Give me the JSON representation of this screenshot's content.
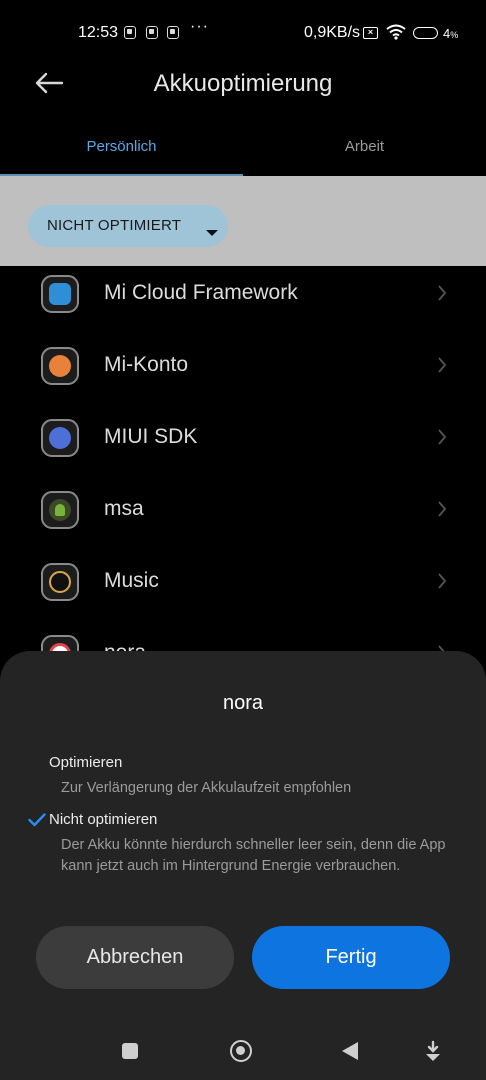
{
  "status_bar": {
    "time": "12:53",
    "dots": "···",
    "network_speed": "0,9KB/s",
    "battery": "4",
    "battery_unit": "%"
  },
  "header": {
    "title": "Akkuoptimierung",
    "back_icon": "arrow-left-icon"
  },
  "tabs": [
    {
      "label": "Persönlich",
      "active": true
    },
    {
      "label": "Arbeit",
      "active": false
    }
  ],
  "filter": {
    "label": "NICHT OPTIMIERT",
    "icon": "caret-down-icon"
  },
  "apps": [
    {
      "name": "Mi Cloud Framework",
      "icon": "mi-cloud-icon",
      "icon_color": "#2f8fd6"
    },
    {
      "name": "Mi-Konto",
      "icon": "mi-account-icon",
      "icon_color": "#e8823a"
    },
    {
      "name": "MIUI SDK",
      "icon": "miui-sdk-icon",
      "icon_color": "#4f6fd8"
    },
    {
      "name": "msa",
      "icon": "android-icon",
      "icon_color": "#78b33a"
    },
    {
      "name": "Music",
      "icon": "music-disc-icon",
      "icon_color": "#d9a84a"
    },
    {
      "name": "nora",
      "icon": "nora-icon",
      "icon_color": "#e0454f"
    }
  ],
  "sheet": {
    "title": "nora",
    "options": [
      {
        "label": "Optimieren",
        "description": "Zur Verlängerung der Akkulaufzeit empfohlen",
        "selected": false
      },
      {
        "label": "Nicht optimieren",
        "description": "Der Akku könnte hierdurch schneller leer sein, denn die App kann jetzt auch im Hintergrund Energie verbrauchen.",
        "selected": true
      }
    ],
    "cancel_label": "Abbrechen",
    "done_label": "Fertig"
  },
  "colors": {
    "accent": "#0d74e0",
    "check": "#2a8df0",
    "tab_active": "#5aa7e6"
  }
}
